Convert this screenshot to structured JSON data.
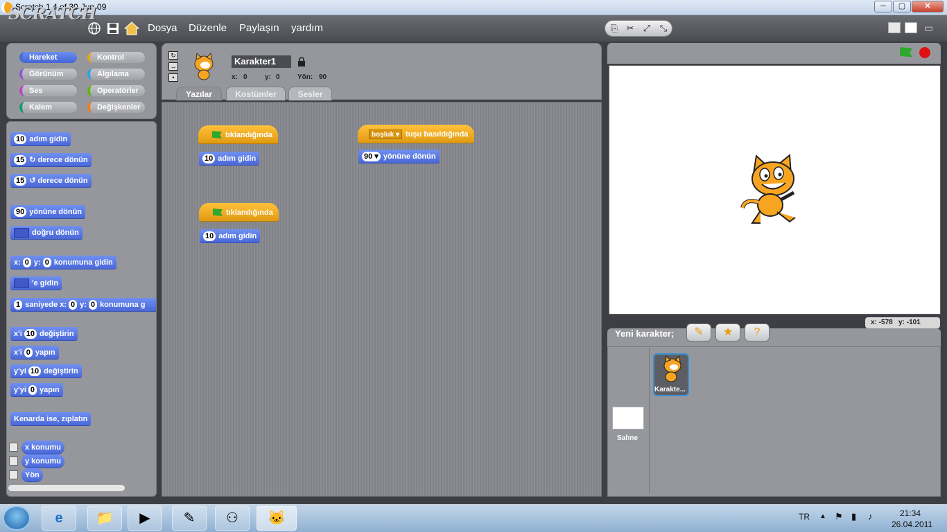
{
  "window": {
    "title": "Scratch 1.4 of 30-Jun-09",
    "min": "─",
    "max": "▢",
    "close": "✕"
  },
  "menu": {
    "logo": "SCRATCH",
    "items": [
      "Dosya",
      "Düzenle",
      "Paylaşın",
      "yardım"
    ],
    "icons": [
      "globe-icon",
      "save-icon",
      "share-icon"
    ]
  },
  "categories": [
    {
      "label": "Hareket",
      "color": "#4a6cd4",
      "active": true
    },
    {
      "label": "Kontrol",
      "color": "#e1a91a",
      "active": false
    },
    {
      "label": "Görünüm",
      "color": "#8a55d7",
      "active": false
    },
    {
      "label": "Algılama",
      "color": "#2ca5e2",
      "active": false
    },
    {
      "label": "Ses",
      "color": "#bb42c3",
      "active": false
    },
    {
      "label": "Operatörler",
      "color": "#5cb712",
      "active": false
    },
    {
      "label": "Kalem",
      "color": "#0e9a6c",
      "active": false
    },
    {
      "label": "Değişkenler",
      "color": "#ee7d16",
      "active": false
    }
  ],
  "palette": {
    "move": {
      "num": "10",
      "text": "adım gidin"
    },
    "turn_right": {
      "num": "15",
      "icon": "↻",
      "text": "derece dönün"
    },
    "turn_left": {
      "num": "15",
      "icon": "↺",
      "text": "derece dönün"
    },
    "point_dir": {
      "num": "90",
      "text": "yönüne dönün"
    },
    "point_towards": {
      "text": "doğru dönün"
    },
    "goto_xy": {
      "x_label": "x:",
      "x": "0",
      "y_label": "y:",
      "y": "0",
      "text": "konumuna gidin"
    },
    "goto": {
      "text": "'e gidin"
    },
    "glide": {
      "num": "1",
      "text1": "saniyede x:",
      "x": "0",
      "y_label": "y:",
      "y": "0",
      "text2": "konumuna g"
    },
    "change_x": {
      "label": "x'i",
      "num": "10",
      "text": "değiştirin"
    },
    "set_x": {
      "label": "x'i",
      "num": "0",
      "text": "yapın"
    },
    "change_y": {
      "label": "y'yi",
      "num": "10",
      "text": "değiştirin"
    },
    "set_y": {
      "label": "y'yi",
      "num": "0",
      "text": "yapın"
    },
    "bounce": {
      "text": "Kenarda ise, zıplatın"
    },
    "reporters": [
      "x konumu",
      "y konumu",
      "Yön"
    ]
  },
  "sprite": {
    "name": "Karakter1",
    "x_label": "x:",
    "x": "0",
    "y_label": "y:",
    "y": "0",
    "dir_label": "Yön:",
    "dir": "90"
  },
  "tabs": [
    "Yazılar",
    "Kostümler",
    "Sesler"
  ],
  "scripts": {
    "s1": {
      "hat": "tıklandığında",
      "block_num": "10",
      "block_text": "adım gidin"
    },
    "s2": {
      "key": "boşluk",
      "hat": "tuşu basıldığında",
      "block_num": "90",
      "block_text": "yönüne dönün"
    },
    "s3": {
      "hat": "tıklandığında",
      "block_num": "10",
      "block_text": "adım gidin"
    }
  },
  "stage": {
    "mouse_x_label": "x:",
    "mouse_x": "-578",
    "mouse_y_label": "y:",
    "mouse_y": "-101"
  },
  "new_sprite": {
    "label": "Yeni karakter;",
    "buttons": [
      "paint-sprite-icon",
      "choose-sprite-icon",
      "surprise-sprite-icon"
    ]
  },
  "sprite_list": {
    "stage_label": "Sahne",
    "sprite_label": "Karakte..."
  },
  "taskbar": {
    "lang": "TR",
    "time": "21:34",
    "date": "26.04.2011"
  }
}
